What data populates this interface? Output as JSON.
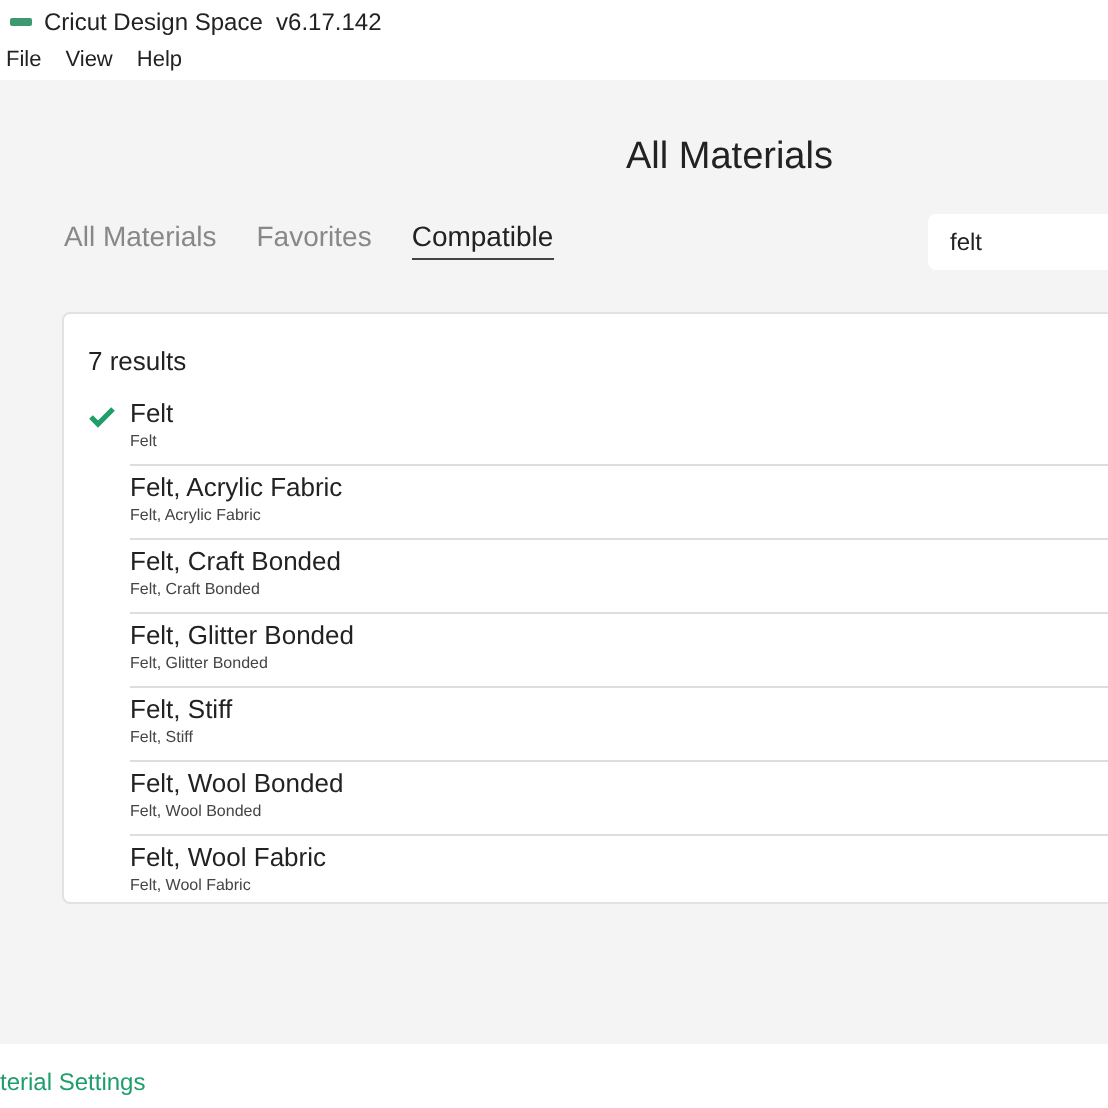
{
  "window": {
    "title": "Cricut Design Space  v6.17.142"
  },
  "menu": [
    "File",
    "View",
    "Help"
  ],
  "heading": "All Materials",
  "tabs": [
    {
      "label": "All Materials",
      "selected": false
    },
    {
      "label": "Favorites",
      "selected": false
    },
    {
      "label": "Compatible",
      "selected": true
    }
  ],
  "search": {
    "value": "felt"
  },
  "results_count": "7 results",
  "materials": [
    {
      "name": "Felt",
      "subtitle": "Felt",
      "selected": true
    },
    {
      "name": "Felt, Acrylic Fabric",
      "subtitle": "Felt, Acrylic Fabric",
      "selected": false
    },
    {
      "name": "Felt, Craft Bonded",
      "subtitle": "Felt, Craft Bonded",
      "selected": false
    },
    {
      "name": "Felt, Glitter Bonded",
      "subtitle": "Felt, Glitter Bonded",
      "selected": false
    },
    {
      "name": "Felt, Stiff",
      "subtitle": "Felt, Stiff",
      "selected": false
    },
    {
      "name": "Felt, Wool Bonded",
      "subtitle": "Felt, Wool Bonded",
      "selected": false
    },
    {
      "name": "Felt, Wool Fabric",
      "subtitle": "Felt, Wool Fabric",
      "selected": false
    }
  ],
  "footer_link": "terial Settings"
}
